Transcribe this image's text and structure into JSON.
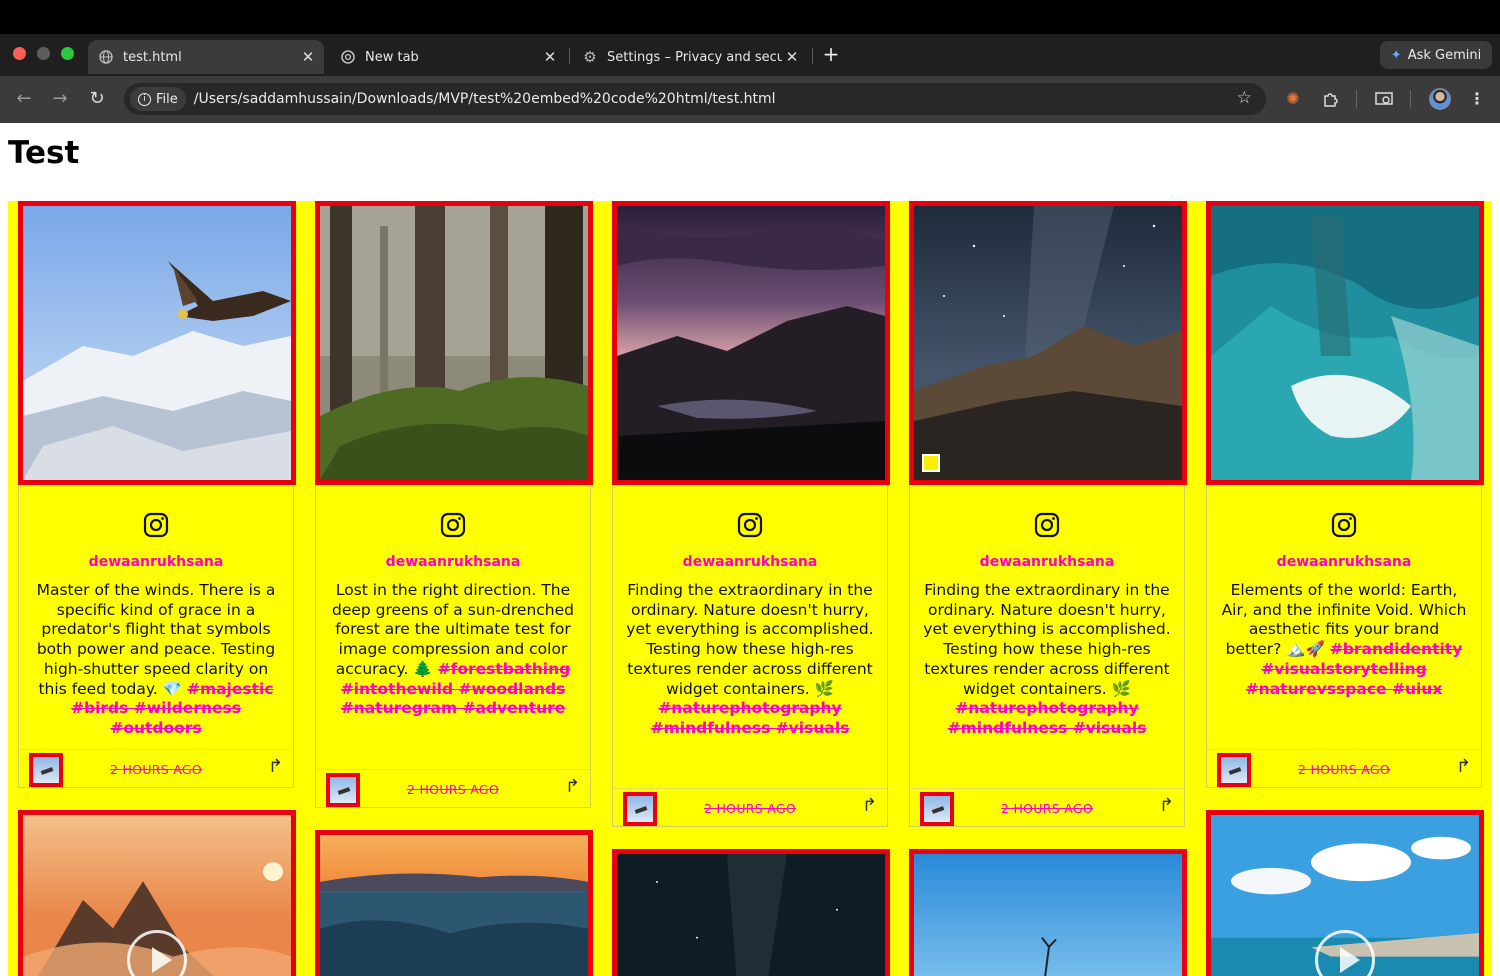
{
  "browser": {
    "tabs": [
      {
        "title": "test.html",
        "active": true,
        "icon": "globe-icon"
      },
      {
        "title": "New tab",
        "active": false,
        "icon": "chrome-icon"
      },
      {
        "title": "Settings – Privacy and securit",
        "active": false,
        "icon": "gear-icon"
      }
    ],
    "ask_gemini": "Ask Gemini",
    "file_chip": "File",
    "url": "/Users/saddamhussain/Downloads/MVP/test%20embed%20code%20html/test.html"
  },
  "page": {
    "title": "Test"
  },
  "posts": [
    {
      "username": "dewaanrukhsana",
      "caption": "Master of the winds. There is a specific kind of grace in a predator's flight that symbols both power and peace. Testing high-shutter speed clarity on this feed today. 💎",
      "tags": "#majestic #birds #wilderness #outdoors",
      "time": "2 HOURS AGO",
      "image": "eagle-photo"
    },
    {
      "username": "dewaanrukhsana",
      "caption": "Lost in the right direction. The deep greens of a sun-drenched forest are the ultimate test for image compression and color accuracy. 🌲",
      "tags": "#forestbathing #intothewild #woodlands #naturegram #adventure",
      "time": "2 HOURS AGO",
      "image": "forest-photo"
    },
    {
      "username": "dewaanrukhsana",
      "caption": "Finding the extraordinary in the ordinary. Nature doesn't hurry, yet everything is accomplished. Testing how these high-res textures render across different widget containers. 🌿",
      "tags": "#naturephotography #mindfulness #visuals",
      "time": "2 HOURS AGO",
      "image": "mountain-sunset-photo"
    },
    {
      "username": "dewaanrukhsana",
      "caption": "Finding the extraordinary in the ordinary. Nature doesn't hurry, yet everything is accomplished. Testing how these high-res textures render across different widget containers. 🌿",
      "tags": "#naturephotography #mindfulness #visuals",
      "time": "2 HOURS AGO",
      "image": "milky-way-mountain-photo"
    },
    {
      "username": "dewaanrukhsana",
      "caption": "Elements of the world: Earth, Air, and the infinite Void. Which aesthetic fits your brand better? 🏔️🚀",
      "tags": "#brandidentity #visualstorytelling #naturevsspace #uiux",
      "time": "2 HOURS AGO",
      "image": "ocean-aerial-photo"
    }
  ],
  "colors": {
    "grid_background": "#ffff00",
    "frame_border": "#e80010",
    "accent_pink": "#ff00cc"
  }
}
